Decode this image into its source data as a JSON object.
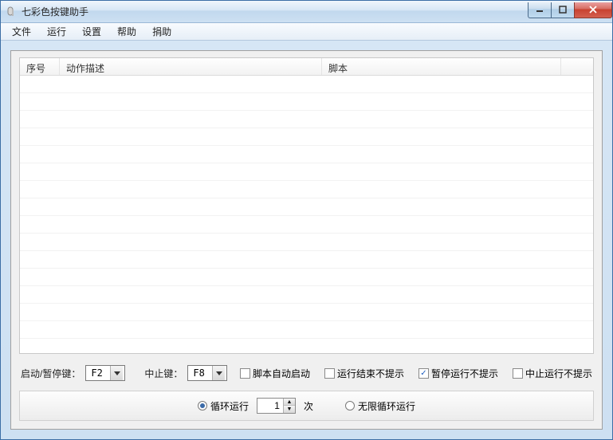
{
  "window": {
    "title": "七彩色按键助手"
  },
  "menu": {
    "file": "文件",
    "run": "运行",
    "settings": "设置",
    "help": "帮助",
    "donate": "捐助"
  },
  "table": {
    "headers": {
      "index": "序号",
      "action_desc": "动作描述",
      "script": "脚本"
    },
    "rows": []
  },
  "controls": {
    "start_pause_key_label": "启动/暂停键：",
    "start_pause_key_value": "F2",
    "stop_key_label": "中止键：",
    "stop_key_value": "F8",
    "auto_start_label": "脚本自动启动",
    "auto_start_checked": false,
    "end_no_prompt_label": "运行结束不提示",
    "end_no_prompt_checked": false,
    "pause_no_prompt_label": "暂停运行不提示",
    "pause_no_prompt_checked": true,
    "stop_no_prompt_label": "中止运行不提示",
    "stop_no_prompt_checked": false
  },
  "loop": {
    "loop_run_label": "循环运行",
    "loop_count": "1",
    "times_label": "次",
    "infinite_loop_label": "无限循环运行",
    "selected": "loop_run"
  }
}
